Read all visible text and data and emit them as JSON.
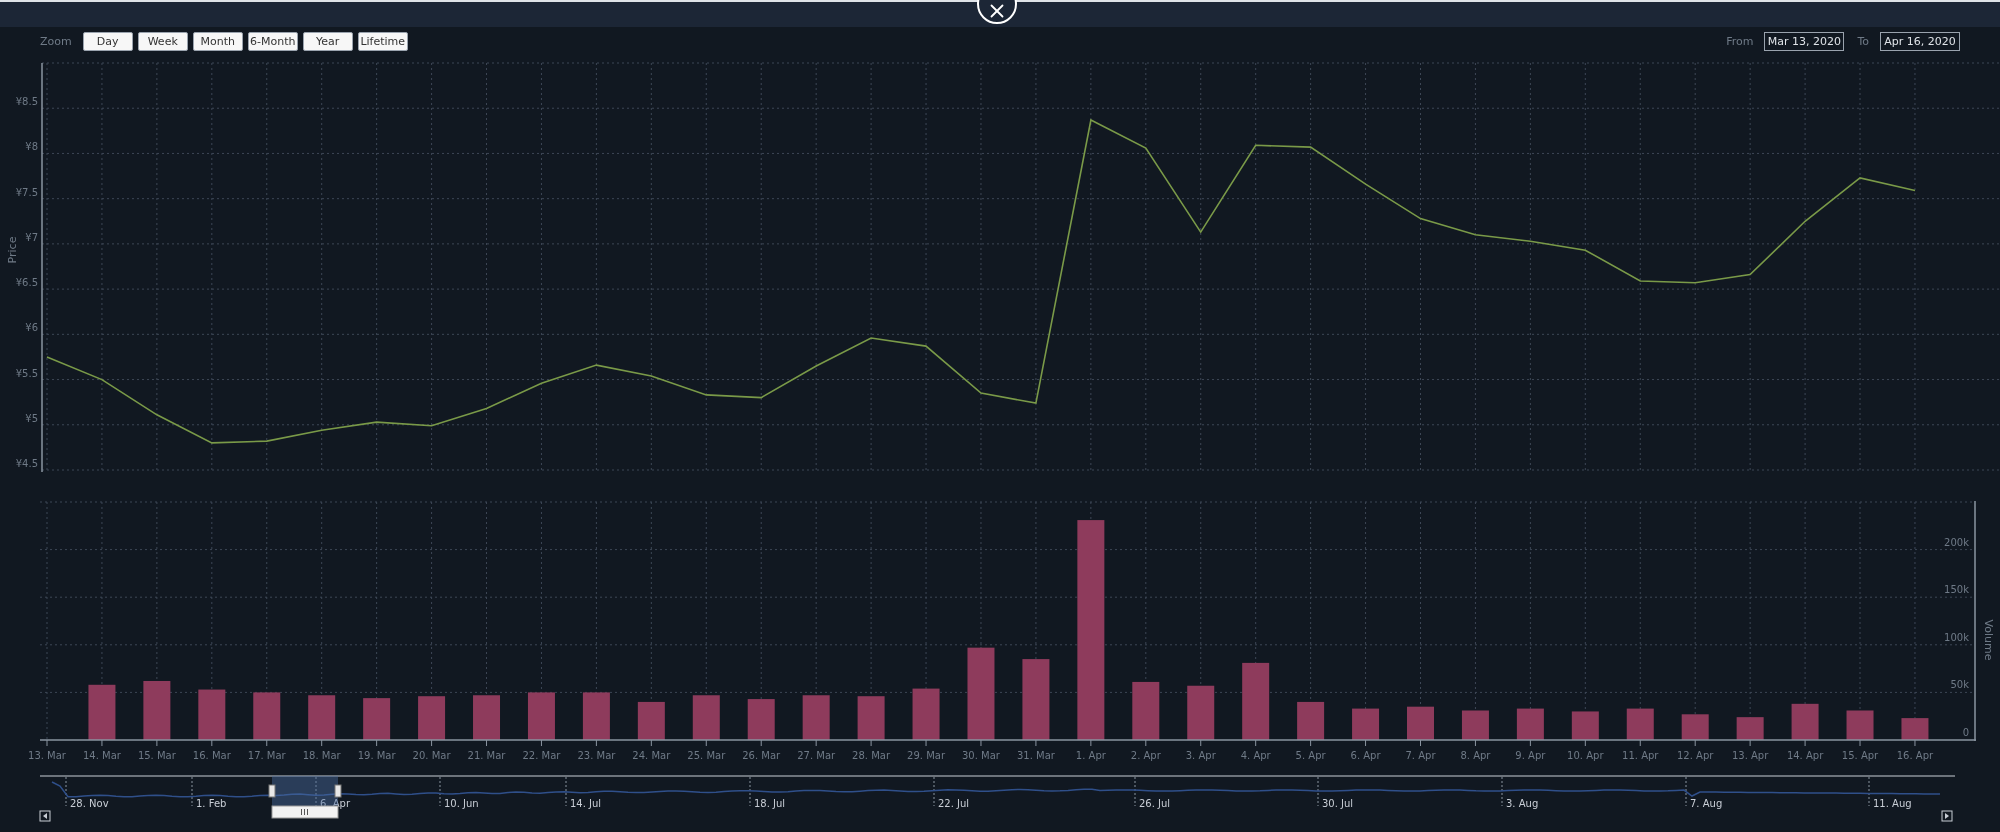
{
  "zoom": {
    "label": "Zoom",
    "buttons": [
      {
        "label": "Day",
        "selected": false
      },
      {
        "label": "Week",
        "selected": false
      },
      {
        "label": "Month",
        "selected": false
      },
      {
        "label": "6-Month",
        "selected": false
      },
      {
        "label": "Year",
        "selected": false
      },
      {
        "label": "Lifetime",
        "selected": false
      }
    ]
  },
  "range": {
    "from_label": "From",
    "from_value": "Mar 13, 2020",
    "to_label": "To",
    "to_value": "Apr 16, 2020"
  },
  "price_chart": {
    "chart_data": {
      "type": "line",
      "ylabel": "Price",
      "ylim": [
        4.5,
        9
      ],
      "grid": true,
      "yticks": [
        {
          "value": 4.5,
          "label": "¥4.5"
        },
        {
          "value": 5,
          "label": "¥5"
        },
        {
          "value": 5.5,
          "label": "¥5.5"
        },
        {
          "value": 6,
          "label": "¥6"
        },
        {
          "value": 6.5,
          "label": "¥6.5"
        },
        {
          "value": 7,
          "label": "¥7"
        },
        {
          "value": 7.5,
          "label": "¥7.5"
        },
        {
          "value": 8,
          "label": "¥8"
        },
        {
          "value": 8.5,
          "label": "¥8.5"
        }
      ],
      "series": [
        {
          "color": "#7a9a48",
          "values": [
            5.75,
            5.5,
            5.11,
            4.8,
            4.82,
            4.94,
            5.03,
            4.99,
            5.18,
            5.46,
            5.66,
            5.54,
            5.33,
            5.3,
            5.65,
            5.96,
            5.87,
            5.35,
            5.24,
            8.37,
            8.06,
            7.13,
            8.09,
            8.07,
            7.66,
            7.28,
            7.1,
            7.03,
            6.93,
            6.59,
            6.57,
            6.66,
            7.25,
            7.73,
            7.59
          ]
        }
      ]
    }
  },
  "volume_chart": {
    "chart_data": {
      "type": "bar",
      "ylabel": "Volume",
      "ylim": [
        0,
        250000
      ],
      "grid": true,
      "categories": [
        "13. Mar",
        "14. Mar",
        "15. Mar",
        "16. Mar",
        "17. Mar",
        "18. Mar",
        "19. Mar",
        "20. Mar",
        "21. Mar",
        "22. Mar",
        "23. Mar",
        "24. Mar",
        "25. Mar",
        "26. Mar",
        "27. Mar",
        "28. Mar",
        "29. Mar",
        "30. Mar",
        "31. Mar",
        "1. Apr",
        "2. Apr",
        "3. Apr",
        "4. Apr",
        "5. Apr",
        "6. Apr",
        "7. Apr",
        "8. Apr",
        "9. Apr",
        "10. Apr",
        "11. Apr",
        "12. Apr",
        "13. Apr",
        "14. Apr",
        "15. Apr",
        "16. Apr"
      ],
      "yticks": [
        {
          "value": 0,
          "label": "0"
        },
        {
          "value": 50000,
          "label": "50k"
        },
        {
          "value": 100000,
          "label": "100k"
        },
        {
          "value": 150000,
          "label": "150k"
        },
        {
          "value": 200000,
          "label": "200k"
        }
      ],
      "series": [
        {
          "color": "#8e3b5c",
          "values": [
            null,
            58000,
            62000,
            53000,
            50000,
            47000,
            44000,
            46000,
            47000,
            50000,
            50000,
            40000,
            47000,
            43000,
            47000,
            46000,
            54000,
            97000,
            85000,
            231000,
            61000,
            57000,
            81000,
            40000,
            33000,
            35000,
            31000,
            33000,
            30000,
            33000,
            27000,
            24000,
            38000,
            31000,
            23000
          ]
        }
      ]
    }
  },
  "navigator": {
    "labels": [
      "28. Nov",
      "1. Feb",
      "6. Apr",
      "10. Jun",
      "14. Jul",
      "18. Jul",
      "22. Jul",
      "26. Jul",
      "30. Jul",
      "3. Aug",
      "7. Aug",
      "11. Aug"
    ]
  }
}
